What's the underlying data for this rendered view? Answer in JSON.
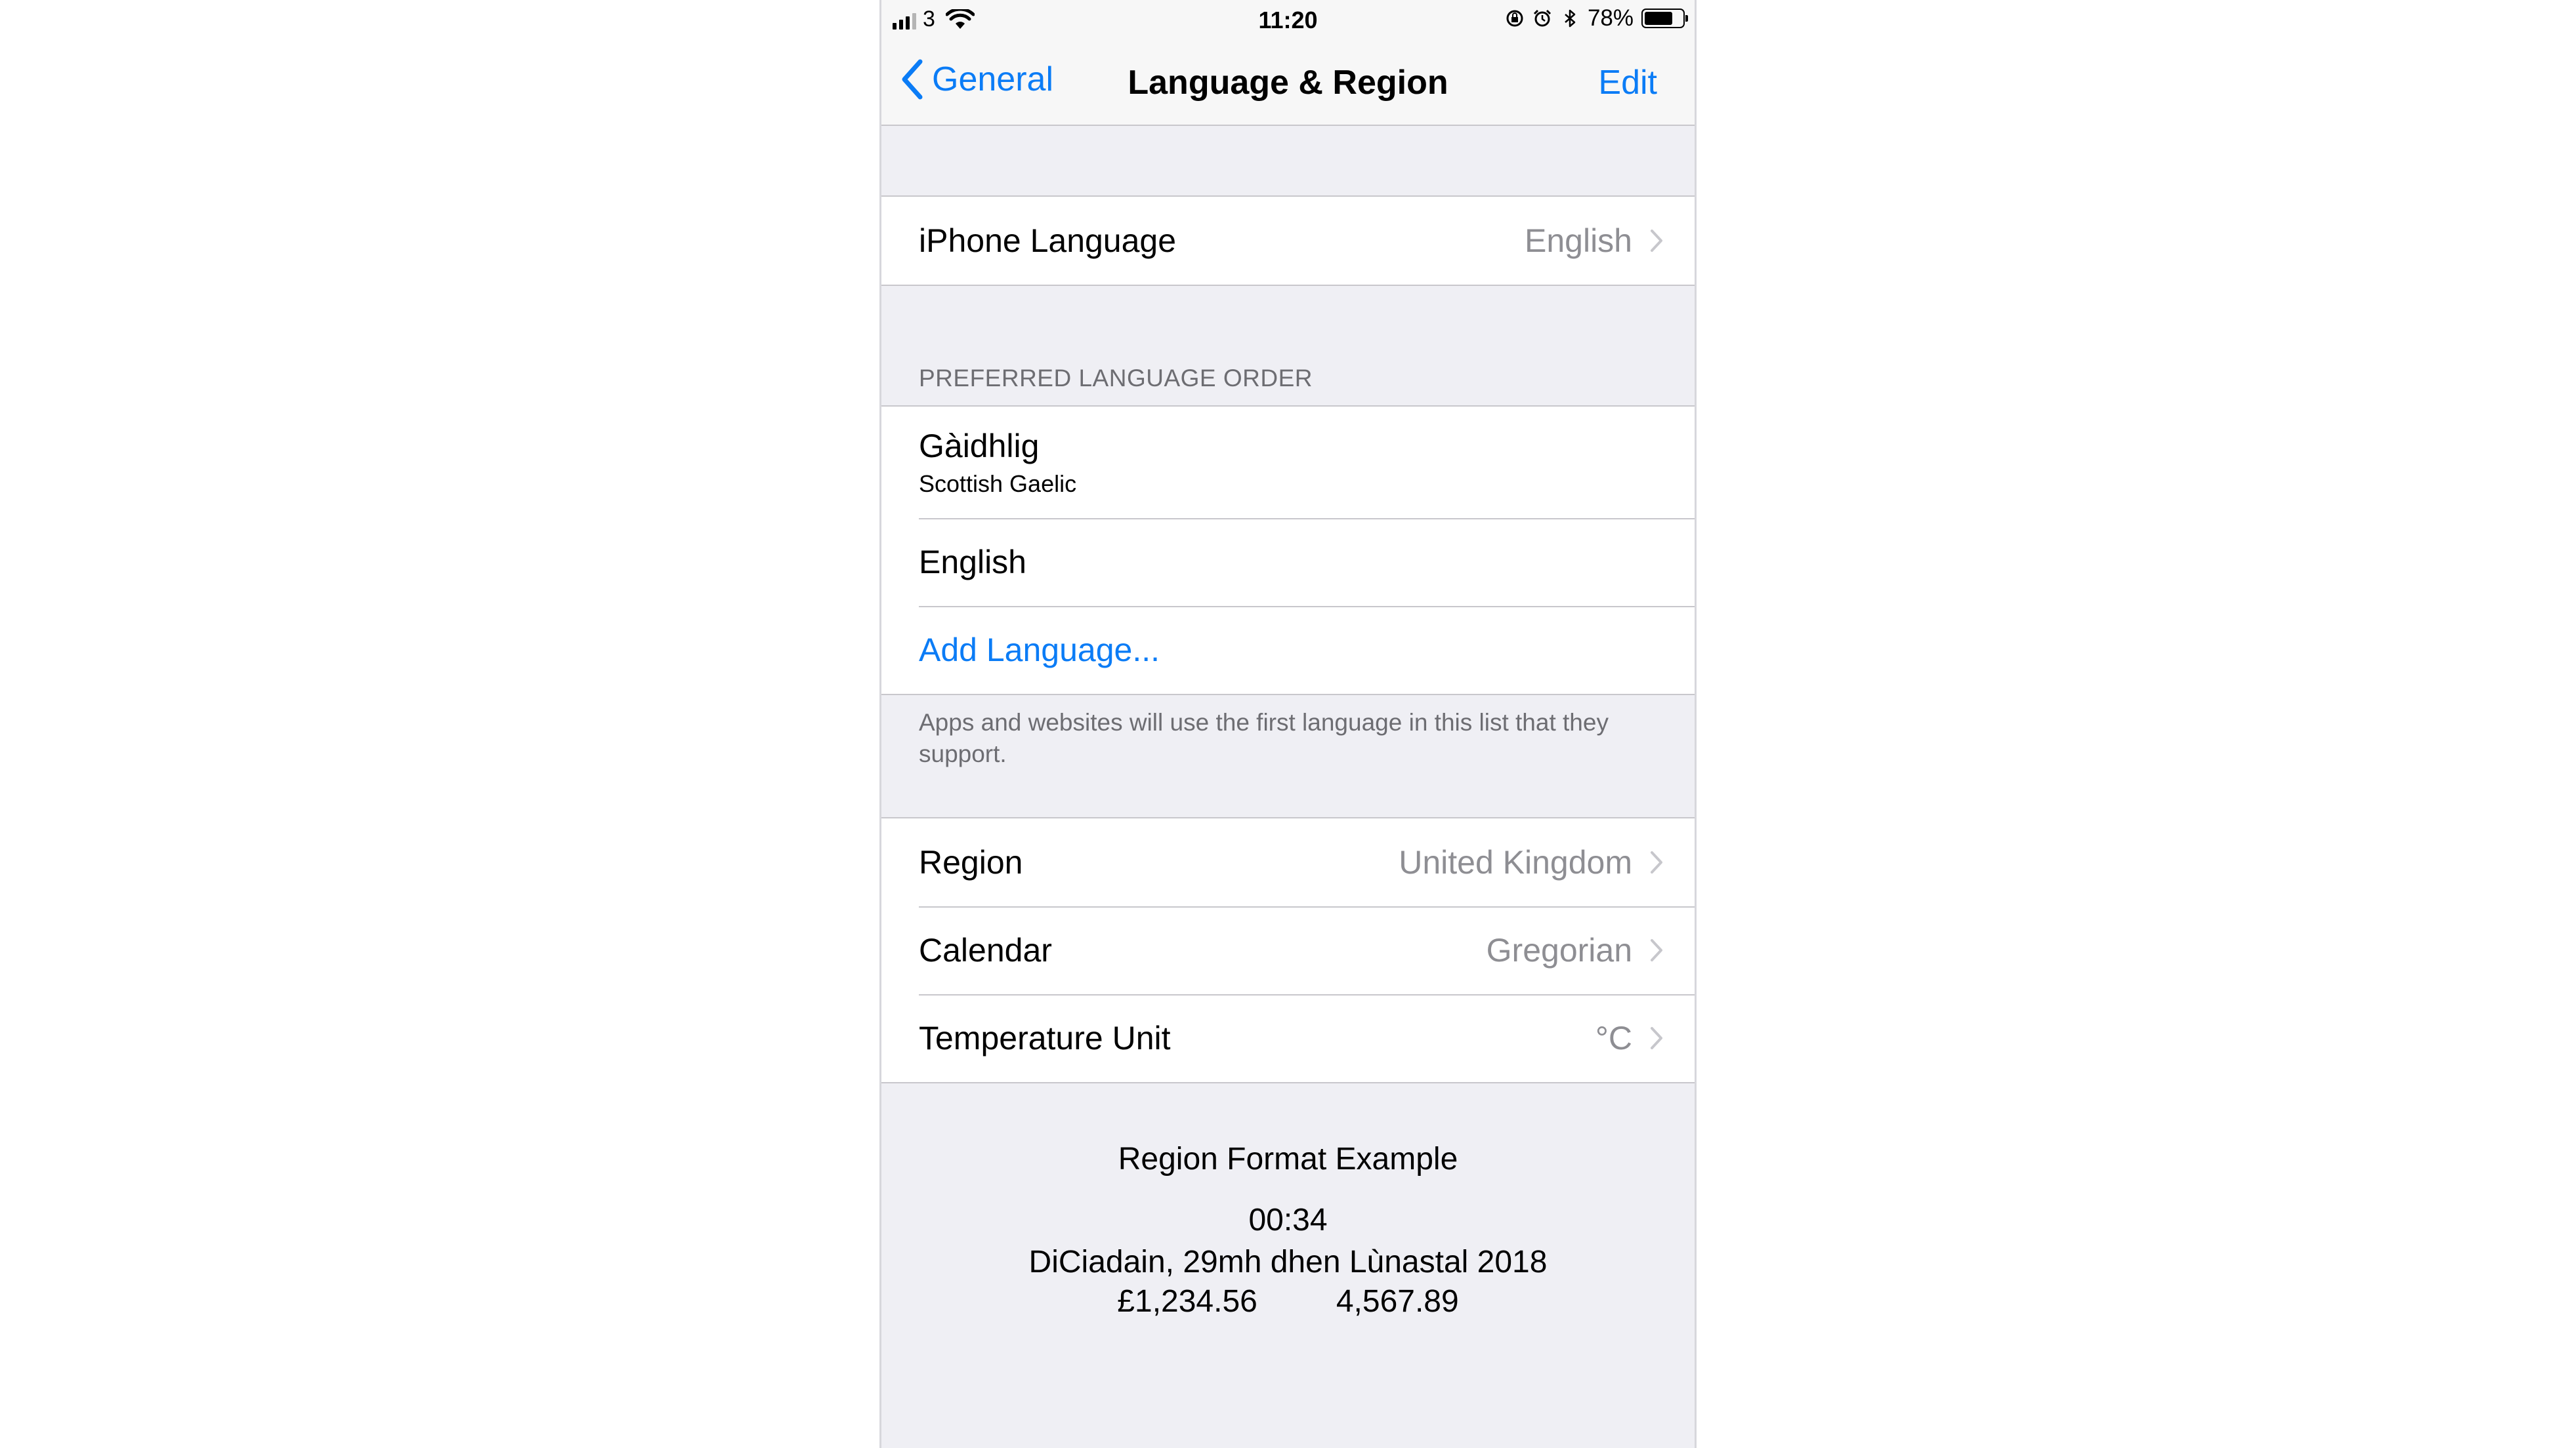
{
  "status_bar": {
    "carrier": "3",
    "time": "11:20",
    "battery": "78%",
    "battery_level": 0.78,
    "icons": [
      "signal-icon",
      "wifi-icon",
      "rotation-lock-icon",
      "alarm-icon",
      "bluetooth-icon",
      "battery-icon"
    ]
  },
  "nav": {
    "back_label": "General",
    "title": "Language & Region",
    "edit_label": "Edit"
  },
  "iphone_language": {
    "label": "iPhone Language",
    "value": "English"
  },
  "preferred_order": {
    "header": "PREFERRED LANGUAGE ORDER",
    "languages": [
      {
        "name": "Gàidhlig",
        "subtitle": "Scottish Gaelic"
      },
      {
        "name": "English"
      }
    ],
    "add_label": "Add Language...",
    "footer": "Apps and websites will use the first language in this list that they support."
  },
  "regional": {
    "region_label": "Region",
    "region_value": "United Kingdom",
    "calendar_label": "Calendar",
    "calendar_value": "Gregorian",
    "temperature_label": "Temperature Unit",
    "temperature_value": "°C"
  },
  "format_example": {
    "title": "Region Format Example",
    "time": "00:34",
    "date": "DiCiadain, 29mh dhen Lùnastal 2018",
    "currency": "£1,234.56",
    "number": "4,567.89"
  },
  "colors": {
    "accent": "#0b7cf6",
    "background": "#efeff4",
    "secondary_text": "#8e8e93"
  }
}
